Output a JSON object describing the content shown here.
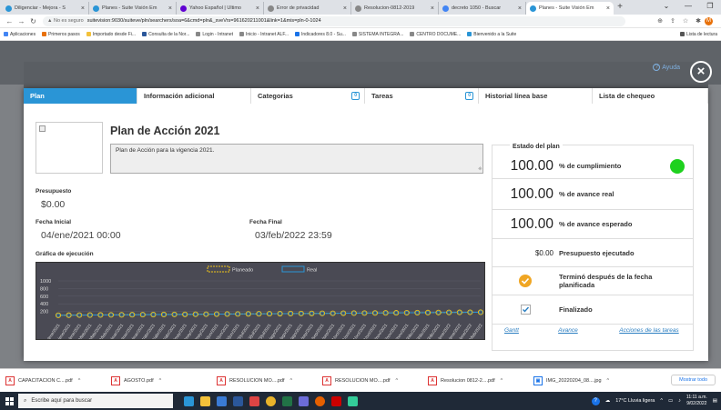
{
  "browser": {
    "tabs": [
      {
        "title": "Diligenciar - Mejora - S",
        "color": "#2a95d6",
        "active": false
      },
      {
        "title": "Planes - Suite Visión Em",
        "color": "#2a95d6",
        "active": false
      },
      {
        "title": "Yahoo Español | Último",
        "color": "#6001d2",
        "active": false
      },
      {
        "title": "Error de privacidad",
        "color": "#888888",
        "active": false
      },
      {
        "title": "Resolucion-0812-2019",
        "color": "#888888",
        "active": false
      },
      {
        "title": "decreto 1050 - Buscar",
        "color": "#4285f4",
        "active": false
      },
      {
        "title": "Planes - Suite Visión Em",
        "color": "#2a95d6",
        "active": true
      }
    ],
    "new_tab": "+",
    "url_warning": "▲ No es seguro",
    "url": "suitevision:9030/suiteve/pln/searchers/soa=6&cmd=pln&_sveVrs=961620211001&link=1&mis=pln-0-1024",
    "bookmarks": [
      "Aplicaciones",
      "Primeros pasos",
      "Importado desde Fi...",
      "Consulta de la Nor...",
      "Login - Intranet",
      "Inicio - Intranet ALF...",
      "Indicadores 8.0 - Su...",
      "SISTEMA INTEGRA...",
      "CENTRO DOCUME...",
      "Bienvenido a la Suite"
    ],
    "reading_list": "Lista de lectura"
  },
  "modal": {
    "help_label": "Ayuda",
    "close_icon": "×",
    "tabs": [
      {
        "label": "Plan",
        "active": true,
        "count": ""
      },
      {
        "label": "Información adicional",
        "active": false,
        "count": ""
      },
      {
        "label": "Categorias",
        "active": false,
        "count": "0"
      },
      {
        "label": "Tareas",
        "active": false,
        "count": "0"
      },
      {
        "label": "Historial línea base",
        "active": false,
        "count": ""
      },
      {
        "label": "Lista de chequeo",
        "active": false,
        "count": ""
      }
    ],
    "title": "Plan de Acción 2021",
    "description": "Plan de Acción para la vigencia 2021.",
    "budget_label": "Presupuesto",
    "budget_value": "$0.00",
    "start_label": "Fecha Inicial",
    "start_value": "04/ene/2021 00:00",
    "end_label": "Fecha Final",
    "end_value": "03/feb/2022 23:59",
    "chart_label": "Gráfica de ejecución"
  },
  "status": {
    "title": "Estado del plan",
    "rows": [
      {
        "value": "100.00",
        "label": "% de cumplimiento"
      },
      {
        "value": "100.00",
        "label": "% de avance real"
      },
      {
        "value": "100.00",
        "label": "% de avance esperado"
      },
      {
        "value": "$0.00",
        "label": "Presupuesto ejecutado"
      }
    ],
    "finished_late": "Terminó después de la fecha planificada",
    "finalized": "Finalizado",
    "status_color": "#1ed11e",
    "links": {
      "gantt": "Gantt",
      "avance": "Avance",
      "acciones": "Acciones de las tareas"
    }
  },
  "chart_data": {
    "type": "line",
    "legend": [
      "Planeado",
      "Real"
    ],
    "legend_placement": "top-center",
    "yticks": [
      200,
      400,
      600,
      800,
      1000
    ],
    "ylim": [
      0,
      1000
    ],
    "x": [
      "04/ene/2021",
      "14/ene/2021",
      "24/ene/2021",
      "03/feb/2021",
      "13/feb/2021",
      "23/feb/2021",
      "05/mar/2021",
      "15/mar/2021",
      "25/mar/2021",
      "04/abr/2021",
      "14/abr/2021",
      "24/abr/2021",
      "04/may/2021",
      "14/may/2021",
      "24/may/2021",
      "03/jun/2021",
      "13/jun/2021",
      "23/jun/2021",
      "03/jul/2021",
      "13/jul/2021",
      "23/jul/2021",
      "02/ago/2021",
      "12/ago/2021",
      "22/ago/2021",
      "01/sep/2021",
      "11/sep/2021",
      "21/sep/2021",
      "01/oct/2021",
      "11/oct/2021",
      "21/oct/2021",
      "31/oct/2021",
      "10/nov/2021",
      "20/nov/2021",
      "30/nov/2021",
      "10/dic/2021",
      "20/dic/2021",
      "30/dic/2021",
      "09/ene/2022",
      "19/ene/2022",
      "29/ene/2022",
      "03/feb/2022"
    ],
    "series": [
      {
        "name": "Planeado",
        "values": [
          100,
          102,
          104,
          106,
          108,
          110,
          112,
          114,
          116,
          118,
          120,
          122,
          124,
          126,
          128,
          130,
          132,
          134,
          136,
          138,
          140,
          142,
          144,
          146,
          148,
          150,
          152,
          154,
          156,
          158,
          160,
          162,
          164,
          166,
          168,
          170,
          172,
          174,
          176,
          178,
          180
        ]
      },
      {
        "name": "Real",
        "values": [
          100,
          102,
          104,
          106,
          108,
          110,
          112,
          114,
          116,
          118,
          120,
          122,
          124,
          126,
          128,
          130,
          132,
          134,
          136,
          138,
          140,
          142,
          144,
          146,
          148,
          150,
          152,
          154,
          156,
          158,
          160,
          162,
          164,
          166,
          168,
          170,
          172,
          174,
          176,
          178,
          180
        ]
      }
    ]
  },
  "downloads": {
    "items": [
      "CAPACITACION C....pdf",
      "AGOSTO.pdf",
      "RESOLUCION MO....pdf",
      "RESOLUCION MO....pdf",
      "Resolucion 0812-2....pdf",
      "IMG_20220204_08....jpg"
    ],
    "show_all": "Mostrar todo"
  },
  "taskbar": {
    "search_placeholder": "Escribe aquí para buscar",
    "weather": "17°C Lluvia ligera",
    "time": "11:11 a.m.",
    "date": "9/02/2022"
  }
}
